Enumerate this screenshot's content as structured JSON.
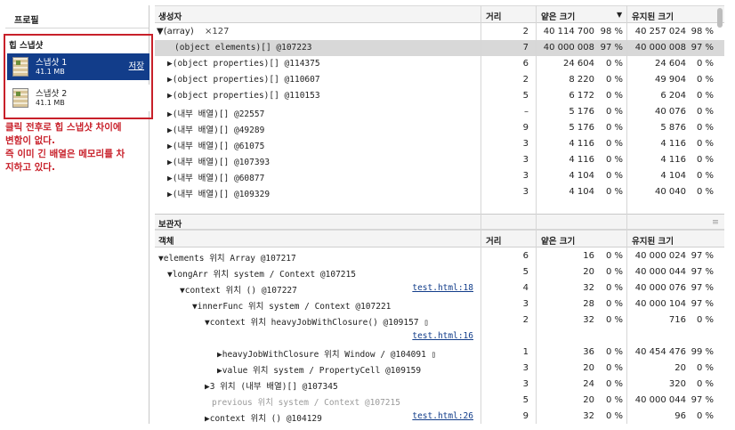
{
  "left": {
    "profiles_title": "프로필",
    "heap_title": "힙 스냅샷",
    "snapshots": [
      {
        "name": "스냅샷 1",
        "size": "41.1 MB",
        "save": "저장"
      },
      {
        "name": "스냅샷 2",
        "size": "41.1 MB"
      }
    ],
    "note": [
      "클릭 전후로 힙 스냅샷 차이에",
      "변함이 없다.",
      "즉 이미 긴 배열은 메모리를 차",
      "지하고 있다."
    ],
    "accent_color": "#c8202a"
  },
  "top_table": {
    "headers": {
      "constructor": "생성자",
      "distance": "거리",
      "shallow": "얕은 크기",
      "sort_icon": "▼",
      "retained": "유지된 크기"
    },
    "rows": [
      {
        "name": "▼(array)",
        "count": "×127",
        "dist": "2",
        "shallow": "40 114 700",
        "spct": "98 %",
        "ret": "40 257 024",
        "rpct": "98 %"
      },
      {
        "name": "(object elements)[] @107223",
        "dist": "7",
        "shallow": "40 000 008",
        "spct": "97 %",
        "ret": "40 000 008",
        "rpct": "97 %"
      },
      {
        "name": "▶(object properties)[] @114375",
        "dist": "6",
        "shallow": "24 604",
        "spct": "0 %",
        "ret": "24 604",
        "rpct": "0 %"
      },
      {
        "name": "▶(object properties)[] @110607",
        "dist": "2",
        "shallow": "8 220",
        "spct": "0 %",
        "ret": "49 904",
        "rpct": "0 %"
      },
      {
        "name": "▶(object properties)[] @110153",
        "dist": "5",
        "shallow": "6 172",
        "spct": "0 %",
        "ret": "6 204",
        "rpct": "0 %"
      },
      {
        "name": "▶(내부 배열)[] @22557",
        "dist": "–",
        "shallow": "5 176",
        "spct": "0 %",
        "ret": "40 076",
        "rpct": "0 %"
      },
      {
        "name": "▶(내부 배열)[] @49289",
        "dist": "9",
        "shallow": "5 176",
        "spct": "0 %",
        "ret": "5 876",
        "rpct": "0 %"
      },
      {
        "name": "▶(내부 배열)[] @61075",
        "dist": "3",
        "shallow": "4 116",
        "spct": "0 %",
        "ret": "4 116",
        "rpct": "0 %"
      },
      {
        "name": "▶(내부 배열)[] @107393",
        "dist": "3",
        "shallow": "4 116",
        "spct": "0 %",
        "ret": "4 116",
        "rpct": "0 %"
      },
      {
        "name": "▶(내부 배열)[] @60877",
        "dist": "3",
        "shallow": "4 104",
        "spct": "0 %",
        "ret": "4 104",
        "rpct": "0 %"
      },
      {
        "name": "▶(내부 배열)[] @109329",
        "dist": "3",
        "shallow": "4 104",
        "spct": "0 %",
        "ret": "40 040",
        "rpct": "0 %"
      }
    ]
  },
  "retainers": {
    "title": "보관자",
    "menu_icon": "≡",
    "headers": {
      "object": "객체",
      "distance": "거리",
      "shallow": "얕은 크기",
      "retained": "유지된 크기"
    },
    "rows": [
      {
        "name": "▼elements 위치 Array @107217",
        "link": "",
        "dist": "6",
        "shallow": "16",
        "spct": "0 %",
        "ret": "40 000 024",
        "rpct": "97 %"
      },
      {
        "name": "▼longArr 위치 system / Context @107215",
        "link": "",
        "dist": "5",
        "shallow": "20",
        "spct": "0 %",
        "ret": "40 000 044",
        "rpct": "97 %"
      },
      {
        "name": "▼context 위치 () @107227",
        "link": "test.html:18",
        "dist": "4",
        "shallow": "32",
        "spct": "0 %",
        "ret": "40 000 076",
        "rpct": "97 %"
      },
      {
        "name": "▼innerFunc 위치 system / Context @107221",
        "link": "",
        "dist": "3",
        "shallow": "28",
        "spct": "0 %",
        "ret": "40 000 104",
        "rpct": "97 %"
      },
      {
        "name": "▼context 위치 heavyJobWithClosure() @109157 ▯",
        "link": "",
        "dist": "2",
        "shallow": "32",
        "spct": "0 %",
        "ret": "716",
        "rpct": "0 %"
      },
      {
        "name": "",
        "link": "test.html:16",
        "dist": "",
        "shallow": "",
        "spct": "",
        "ret": "",
        "rpct": ""
      },
      {
        "name": "▶heavyJobWithClosure 위치 Window /  @104091 ▯",
        "link": "",
        "dist": "1",
        "shallow": "36",
        "spct": "0 %",
        "ret": "40 454 476",
        "rpct": "99 %"
      },
      {
        "name": "▶value 위치 system / PropertyCell @109159",
        "link": "",
        "dist": "3",
        "shallow": "20",
        "spct": "0 %",
        "ret": "20",
        "rpct": "0 %"
      },
      {
        "name": "▶3 위치 (내부 배열)[] @107345",
        "link": "",
        "dist": "3",
        "shallow": "24",
        "spct": "0 %",
        "ret": "320",
        "rpct": "0 %"
      },
      {
        "name": "previous 위치 system / Context @107215",
        "link": "",
        "dist": "5",
        "shallow": "20",
        "spct": "0 %",
        "ret": "40 000 044",
        "rpct": "97 %"
      },
      {
        "name": "▶context 위치 () @104129",
        "link": "test.html:26",
        "dist": "9",
        "shallow": "32",
        "spct": "0 %",
        "ret": "96",
        "rpct": "0 %"
      }
    ]
  }
}
